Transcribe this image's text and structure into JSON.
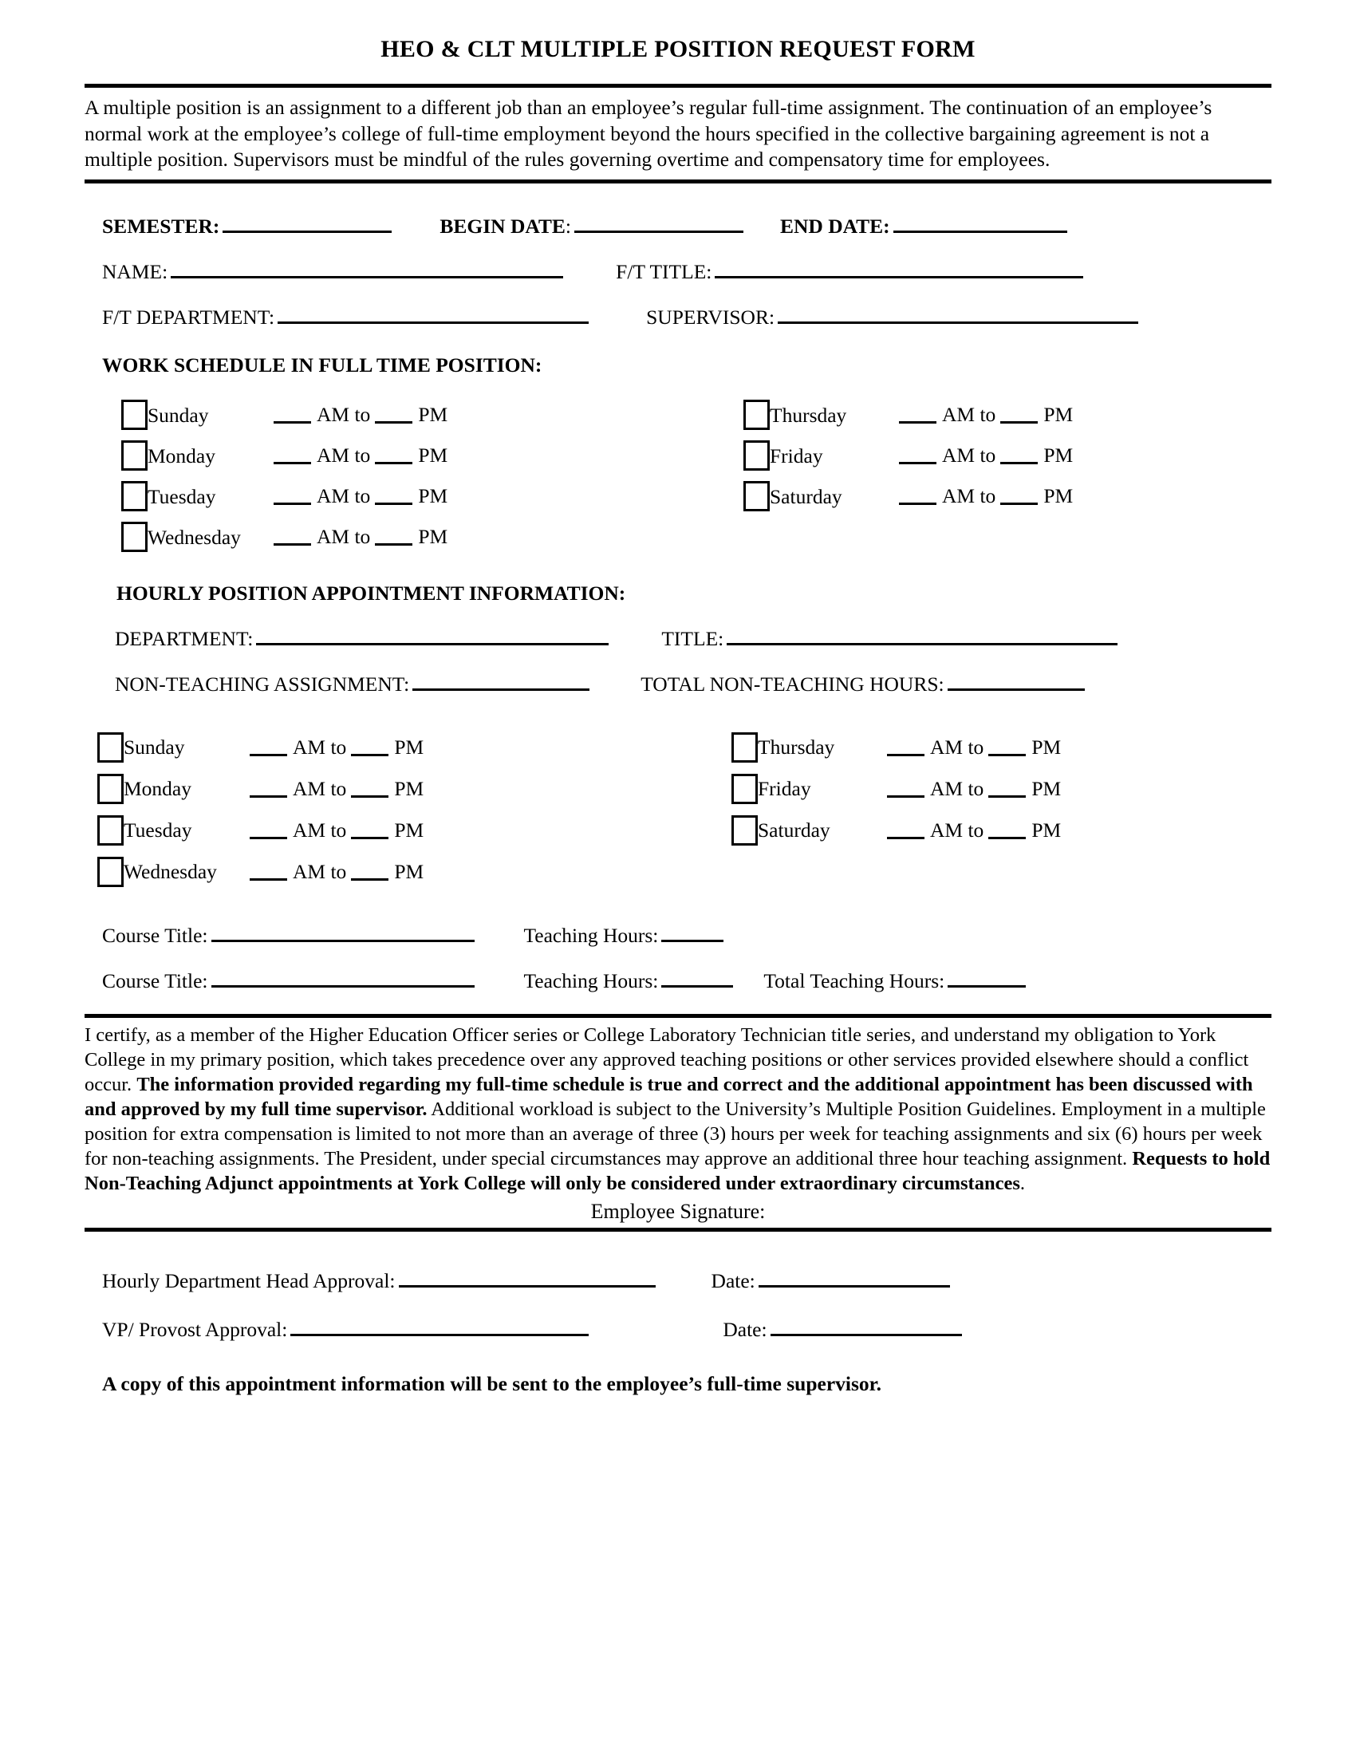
{
  "document": {
    "title": "HEO & CLT MULTIPLE POSITION REQUEST FORM",
    "intro": "A multiple position is an assignment to a different job than an employee’s regular full-time assignment.  The continuation of an employee’s normal work at the employee’s college of full-time employment beyond the hours specified in the collective bargaining agreement is not a multiple position.  Supervisors must be mindful of the rules governing overtime and compensatory time for employees."
  },
  "header_fields": {
    "semester_label": "SEMESTER:",
    "begin_date_label": "BEGIN DATE",
    "begin_date_colon": ":",
    "end_date_label": "END DATE:",
    "name_label": "NAME:",
    "ft_title_label": "F/T TITLE:",
    "ft_department_label": "F/T DEPARTMENT:",
    "supervisor_label": "SUPERVISOR:"
  },
  "work_schedule": {
    "heading": "WORK SCHEDULE IN FULL TIME POSITION:",
    "am_label": "AM to",
    "pm_label": "PM",
    "left_days": [
      "Sunday",
      "Monday",
      "Tuesday",
      "Wednesday"
    ],
    "right_days": [
      "Thursday",
      "Friday",
      "Saturday"
    ]
  },
  "hourly_position": {
    "heading": "HOURLY POSITION APPOINTMENT INFORMATION:",
    "department_label": "DEPARTMENT:",
    "title_label": "TITLE:",
    "non_teaching_assignment_label": "NON-TEACHING ASSIGNMENT:",
    "total_non_teaching_hours_label": "TOTAL NON-TEACHING HOURS:",
    "am_label": "AM to",
    "pm_label": "PM",
    "left_days": [
      "Sunday",
      "Monday",
      "Tuesday",
      "Wednesday"
    ],
    "right_days": [
      "Thursday",
      "Friday",
      "Saturday"
    ]
  },
  "courses": {
    "course_title_label": "Course Title:",
    "teaching_hours_label": "Teaching Hours:",
    "total_teaching_hours_label": "Total Teaching Hours:"
  },
  "certification": {
    "p1": "I certify, as a member of the Higher Education Officer series or College Laboratory Technician title series, and understand my obligation to York College in my primary position, which takes precedence over any approved teaching positions or other services provided elsewhere should a conflict occur.  ",
    "b1": "The information provided regarding my full-time schedule is true and correct and the additional appointment has been discussed with and approved by my full time supervisor.",
    "p2": " Additional workload is subject to the University’s Multiple Position Guidelines.  Employment in a multiple position for extra compensation is limited to not more than an average of three (3) hours per week for teaching assignments and six (6) hours per week for non-teaching assignments.  The President, under special circumstances may approve an additional three hour teaching assignment.  ",
    "b2": "Requests to hold Non-Teaching Adjunct appointments at York College will only be considered under extraordinary circumstances",
    "p3": ".",
    "signature_label": "Employee Signature:"
  },
  "approvals": {
    "dept_head_label": "Hourly Department Head Approval:",
    "dept_head_date_label": "Date:",
    "vp_provost_label": "VP/ Provost Approval:",
    "vp_provost_date_label": "Date:",
    "footnote": "A copy of this appointment information will be sent to the employee’s full-time supervisor."
  }
}
